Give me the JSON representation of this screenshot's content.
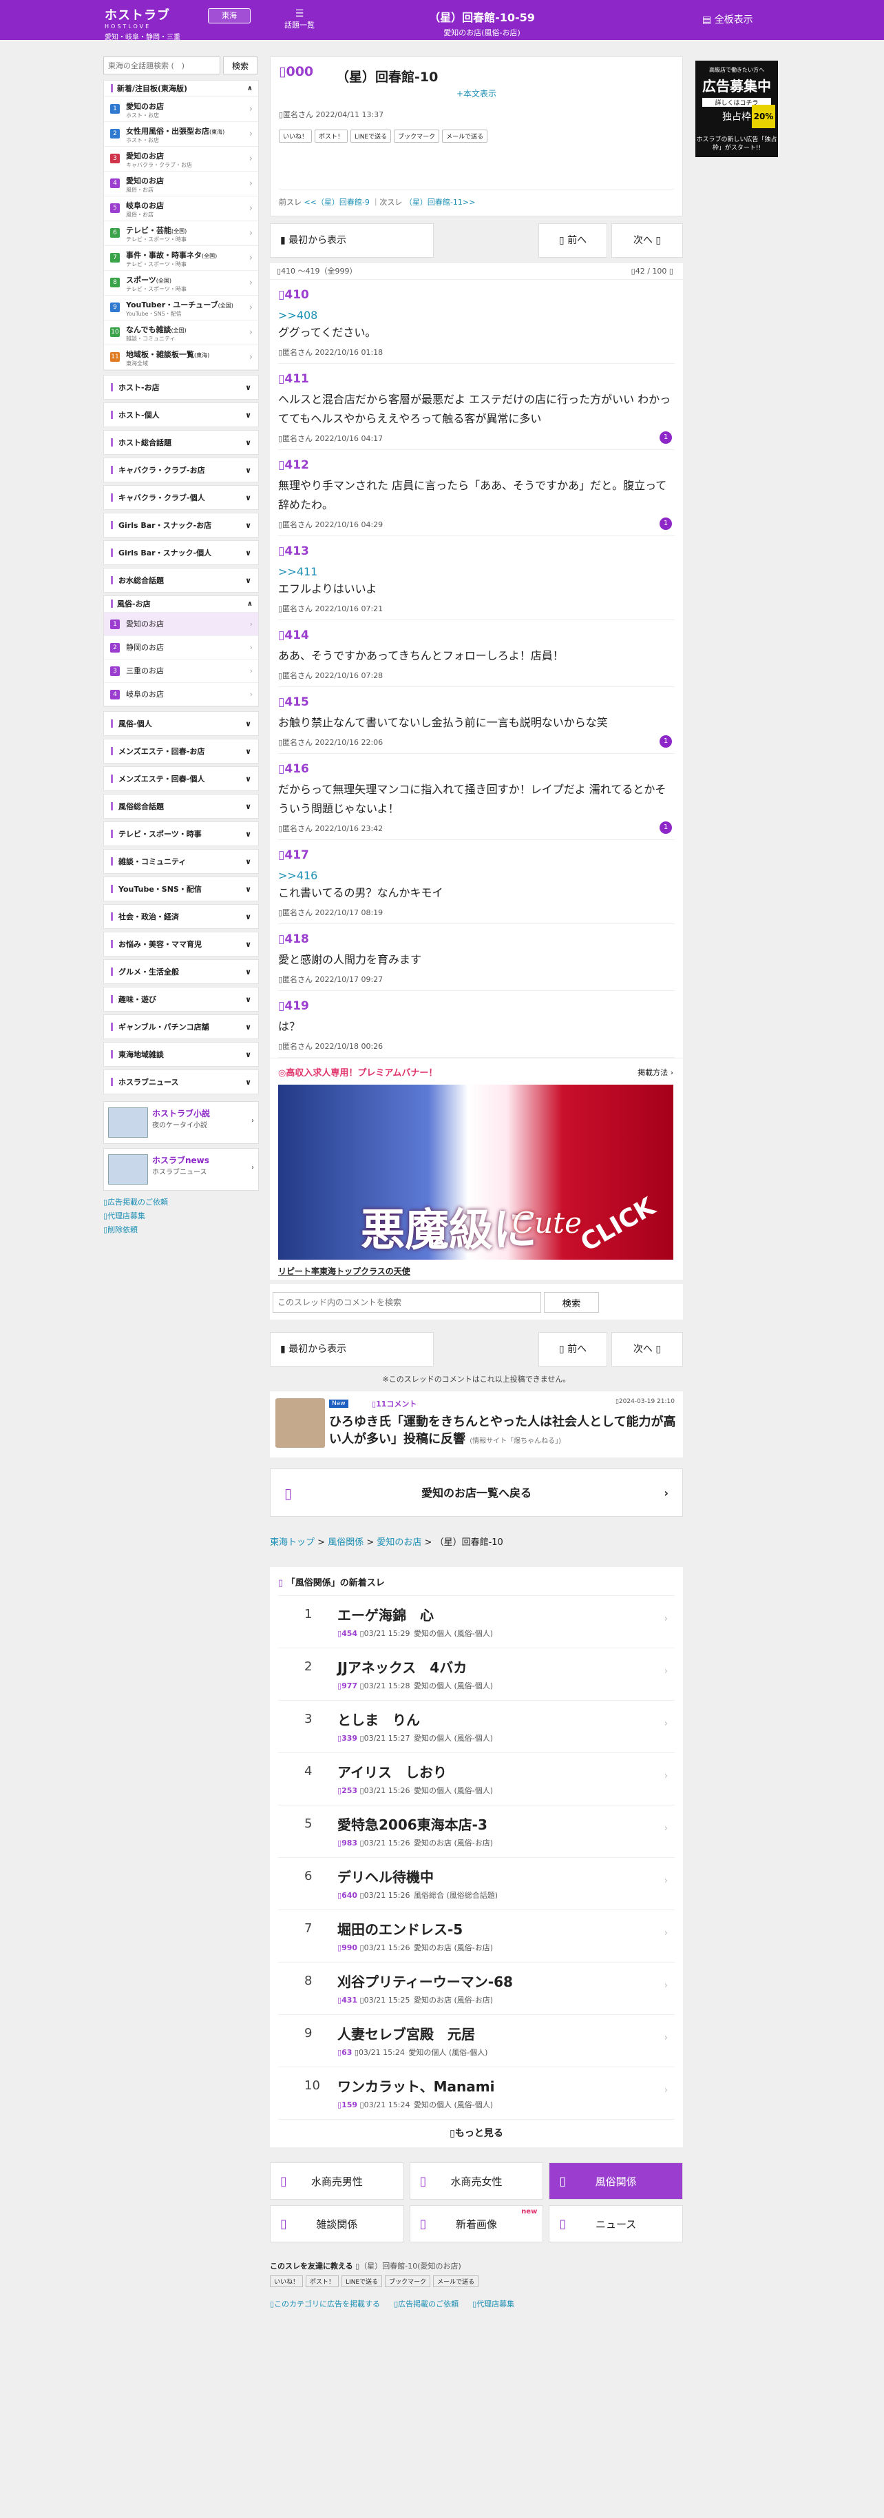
{
  "header": {
    "logo": "ホストラブ",
    "logo_sub": "HOSTLOVE",
    "region_sub": "愛知・岐阜・静岡・三重",
    "area": "東海",
    "index_label": "話題一覧",
    "title": "（星）回春館-10-59",
    "subtitle": "愛知のお店(風俗-お店)",
    "full_label": "全板表示"
  },
  "sidebar": {
    "search_placeholder": "東海の全話題検索 (　)",
    "search_button": "検索",
    "new_group": "新着/注目板(東海版)",
    "items": [
      {
        "num": "1",
        "label": "愛知のお店",
        "sub": "ホスト・お店",
        "color": "#2f7ad0"
      },
      {
        "num": "2",
        "label": "女性用風俗・出張型お店",
        "tag": "(東海)",
        "sub": "ホスト・お店",
        "color": "#2f7ad0"
      },
      {
        "num": "3",
        "label": "愛知のお店",
        "sub": "キャバクラ・クラブ・お店",
        "color": "#d0344a"
      },
      {
        "num": "4",
        "label": "愛知のお店",
        "sub": "風俗・お店",
        "color": "#9b3ed0"
      },
      {
        "num": "5",
        "label": "岐阜のお店",
        "sub": "風俗・お店",
        "color": "#9b3ed0"
      },
      {
        "num": "6",
        "label": "テレビ・芸能",
        "tag": "(全国)",
        "sub": "テレビ・スポーツ・時事",
        "color": "#3aa34a"
      },
      {
        "num": "7",
        "label": "事件・事故・時事ネタ",
        "tag": "(全国)",
        "sub": "テレビ・スポーツ・時事",
        "color": "#3aa34a"
      },
      {
        "num": "8",
        "label": "スポーツ",
        "tag": "(全国)",
        "sub": "テレビ・スポーツ・時事",
        "color": "#3aa34a"
      },
      {
        "num": "9",
        "label": "YouTuber・ユーチューブ",
        "tag": "(全国)",
        "sub": "YouTube・SNS・配信",
        "color": "#2f7ad0"
      },
      {
        "num": "10",
        "label": "なんでも雑談",
        "tag": "(全国)",
        "sub": "雑談・コミュニティ",
        "color": "#3aa34a"
      },
      {
        "num": "11",
        "label": "地域板・雑談板一覧",
        "tag": "(東海)",
        "sub": "東海全域",
        "color": "#e07a20"
      }
    ],
    "cats_top": [
      "ホスト-お店",
      "ホスト-個人",
      "ホスト総合話題",
      "キャバクラ・クラブ-お店",
      "キャバクラ・クラブ-個人",
      "Girls Bar・スナック-お店",
      "Girls Bar・スナック-個人",
      "お水総合話題"
    ],
    "fuzoku_header": "風俗-お店",
    "fuzoku_items": [
      {
        "num": "1",
        "label": "愛知のお店"
      },
      {
        "num": "2",
        "label": "静岡のお店"
      },
      {
        "num": "3",
        "label": "三重のお店"
      },
      {
        "num": "4",
        "label": "岐阜のお店"
      }
    ],
    "cats_bottom": [
      "風俗-個人",
      "メンズエステ・回春-お店",
      "メンズエステ・回春-個人",
      "風俗総合話題",
      "テレビ・スポーツ・時事",
      "雑談・コミュニティ",
      "YouTube・SNS・配信",
      "社会・政治・経済",
      "お悩み・美容・ママ育児",
      "グルメ・生活全般",
      "趣味・遊び",
      "ギャンブル・パチンコ店舗",
      "東海地域雑談",
      "ホスラブニュース"
    ],
    "banners": [
      {
        "title": "ホストラブ小説",
        "sub": "夜のケータイ小説"
      },
      {
        "title": "ホスラブnews",
        "sub": "ホスラブニュース"
      }
    ],
    "links": [
      "広告掲載のご依頼",
      "代理店募集",
      "削除依頼"
    ]
  },
  "thread": {
    "num": "000",
    "title": "（星）回春館-10",
    "body_link": "+本文表示",
    "author": "匿名さん 2022/04/11 13:37",
    "share": [
      "いいね！",
      "ポスト！",
      "LINEで送る",
      "ブックマーク",
      "メールで送る"
    ],
    "nav_prefix": "前スレ",
    "prev_link": "<<（星）回春館-9",
    "nav_mid": "次スレ",
    "next_link": "（星）回春館-11>>"
  },
  "buttons": {
    "first": "最初から表示",
    "prev": "前へ",
    "next": "次へ"
  },
  "pager": {
    "range": "410 ～419（全999）",
    "page": "42 / 100"
  },
  "posts": [
    {
      "num": "410",
      "ref": ">>408",
      "text": "ググってください。",
      "meta": "匿名さん 2022/10/16 01:18",
      "rc": ""
    },
    {
      "num": "411",
      "ref": "",
      "text": "ヘルスと混合店だから客層が最悪だよ エステだけの店に行った方がいい わかっててもヘルスやからええやろって触る客が異常に多い",
      "meta": "匿名さん 2022/10/16 04:17",
      "rc": "1"
    },
    {
      "num": "412",
      "ref": "",
      "text": "無理やり手マンされた 店員に言ったら「ああ、そうですかあ」だと。腹立って辞めたわ。",
      "meta": "匿名さん 2022/10/16 04:29",
      "rc": "1"
    },
    {
      "num": "413",
      "ref": ">>411",
      "text": "エフルよりはいいよ",
      "meta": "匿名さん 2022/10/16 07:21",
      "rc": ""
    },
    {
      "num": "414",
      "ref": "",
      "text": "ああ、そうですかあってきちんとフォローしろよ！店員！",
      "meta": "匿名さん 2022/10/16 07:28",
      "rc": ""
    },
    {
      "num": "415",
      "ref": "",
      "text": "お触り禁止なんて書いてないし金払う前に一言も説明ないからな笑",
      "meta": "匿名さん 2022/10/16 22:06",
      "rc": "1"
    },
    {
      "num": "416",
      "ref": "",
      "text": "だからって無理矢理マンコに指入れて掻き回すか！レイプだよ 濡れてるとかそういう問題じゃないよ！",
      "meta": "匿名さん 2022/10/16 23:42",
      "rc": "1"
    },
    {
      "num": "417",
      "ref": ">>416",
      "text": "これ書いてるの男？なんかキモイ",
      "meta": "匿名さん 2022/10/17 08:19",
      "rc": ""
    },
    {
      "num": "418",
      "ref": "",
      "text": "愛と感謝の人間力を育みます",
      "meta": "匿名さん 2022/10/17 09:27",
      "rc": ""
    },
    {
      "num": "419",
      "ref": "",
      "text": "は？",
      "meta": "匿名さん 2022/10/18 00:26",
      "rc": ""
    }
  ],
  "premium": {
    "head": "◎高収入求人専用！プレミアムバナー！",
    "right": "掲載方法",
    "w1": "悪魔級に",
    "w2": "Cute",
    "w3": "CLICK",
    "caption": "リピート率東海トップクラスの天使"
  },
  "comment_search": {
    "placeholder": "このスレッド内のコメントを検索",
    "button": "検索"
  },
  "closed_note": "※このスレッドのコメントはこれ以上投稿できません。",
  "summary": {
    "tag": "New",
    "count": "11コメント",
    "date": "2024-03-19 21:10",
    "title": "ひろゆき氏「運動をきちんとやった人は社会人として能力が高い人が多い」投稿に反響",
    "src": "(情報サイト「爆ちゃんねる」)"
  },
  "back": "愛知のお店一覧へ戻る",
  "breadcrumb": {
    "c1": "東海トップ",
    "c2": "風俗関係",
    "c3": "愛知のお店",
    "cur": "（星）回春館-10",
    "sep": " > "
  },
  "newlist": {
    "header": "「風俗関係」の新着スレ",
    "more": "もっと見る",
    "items": [
      {
        "rank": "1",
        "title": "エーゲ海錦　心",
        "count": "454",
        "time": "03/21 15:29",
        "cat": "愛知の個人 (風俗-個人)"
      },
      {
        "rank": "2",
        "title": "JJアネックス　4バカ",
        "count": "977",
        "time": "03/21 15:28",
        "cat": "愛知の個人 (風俗-個人)"
      },
      {
        "rank": "3",
        "title": "としま　りん",
        "count": "339",
        "time": "03/21 15:27",
        "cat": "愛知の個人 (風俗-個人)"
      },
      {
        "rank": "4",
        "title": "アイリス　しおり",
        "count": "253",
        "time": "03/21 15:26",
        "cat": "愛知の個人 (風俗-個人)"
      },
      {
        "rank": "5",
        "title": "愛特急2006東海本店-3",
        "count": "983",
        "time": "03/21 15:26",
        "cat": "愛知のお店 (風俗-お店)"
      },
      {
        "rank": "6",
        "title": "デリヘル待機中",
        "count": "640",
        "time": "03/21 15:26",
        "cat": "風俗総合 (風俗総合話題)"
      },
      {
        "rank": "7",
        "title": "堀田のエンドレス-5",
        "count": "990",
        "time": "03/21 15:26",
        "cat": "愛知のお店 (風俗-お店)"
      },
      {
        "rank": "8",
        "title": "刈谷プリティーウーマン-68",
        "count": "431",
        "time": "03/21 15:25",
        "cat": "愛知のお店 (風俗-お店)"
      },
      {
        "rank": "9",
        "title": "人妻セレブ宮殿　元居",
        "count": "63",
        "time": "03/21 15:24",
        "cat": "愛知の個人 (風俗-個人)"
      },
      {
        "rank": "10",
        "title": "ワンカラット、Manami",
        "count": "159",
        "time": "03/21 15:24",
        "cat": "愛知の個人 (風俗-個人)"
      }
    ]
  },
  "categories": [
    {
      "label": "水商売男性"
    },
    {
      "label": "水商売女性"
    },
    {
      "label": "風俗関係",
      "active": true
    },
    {
      "label": "雑談関係"
    },
    {
      "label": "新着画像",
      "badge": "new"
    },
    {
      "label": "ニュース"
    }
  ],
  "footer": {
    "share_label": "このスレを友達に教える",
    "share_title": "（星）回春館-10(愛知のお店)",
    "share": [
      "いいね！",
      "ポスト！",
      "LINEで送る",
      "ブックマーク",
      "メールで送る"
    ],
    "links": [
      "このカテゴリに広告を掲載する",
      "広告掲載のご依頼",
      "代理店募集"
    ]
  },
  "right_ad": {
    "a1": "高級店で働きたい方へ",
    "a2": "広告募集中",
    "a3": "詳しくはコチラ",
    "a4": "独占枠",
    "a5": "20%",
    "a6": "ホスラブの新しい広告「独占枠」がスタート!!"
  },
  "colors": {
    "brand": "#8d27c8",
    "link": "#1c8fb4",
    "accent": "#9b3ed0"
  }
}
